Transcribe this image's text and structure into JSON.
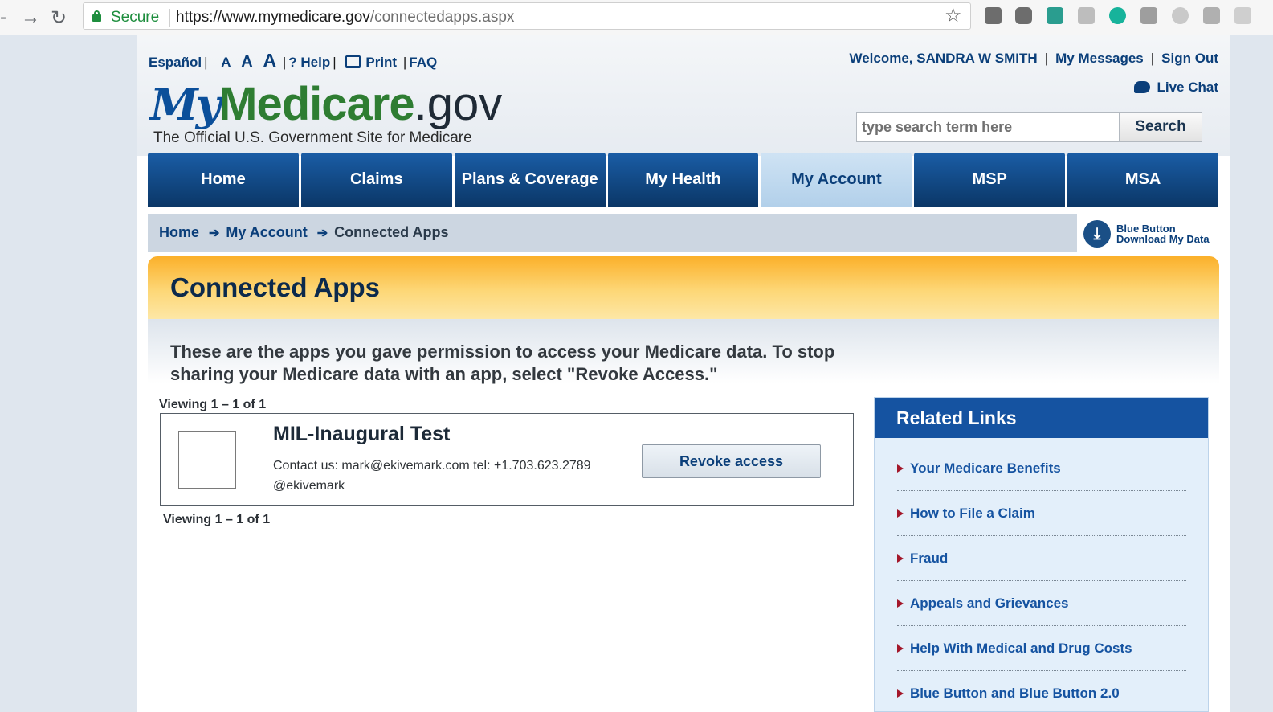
{
  "browser": {
    "secure_label": "Secure",
    "url_host": "https://www.mymedicare.gov",
    "url_path": "/connectedapps.aspx"
  },
  "utility": {
    "espanol": "Español",
    "font_small": "A",
    "font_medium": "A",
    "font_large": "A",
    "help": "? Help",
    "print": "Print",
    "faq": "FAQ"
  },
  "account": {
    "welcome": "Welcome, SANDRA W SMITH",
    "messages": "My Messages",
    "sign_out": "Sign Out",
    "live_chat": "Live Chat"
  },
  "logo": {
    "my": "My",
    "medicare": "Medicare",
    "gov": ".gov",
    "tagline": "The Official U.S. Government Site for Medicare"
  },
  "search": {
    "placeholder": "type search term here",
    "button": "Search"
  },
  "nav": {
    "tabs": [
      {
        "label": "Home",
        "active": false
      },
      {
        "label": "Claims",
        "active": false
      },
      {
        "label": "Plans & Coverage",
        "active": false
      },
      {
        "label": "My Health",
        "active": false
      },
      {
        "label": "My Account",
        "active": true
      },
      {
        "label": "MSP",
        "active": false
      },
      {
        "label": "MSA",
        "active": false
      }
    ]
  },
  "breadcrumb": {
    "items": [
      "Home",
      "My Account",
      "Connected Apps"
    ]
  },
  "blue_button": {
    "line1": "Blue Button",
    "line2": "Download My Data"
  },
  "page": {
    "title": "Connected Apps",
    "intro": "These are the apps you gave permission to access your Medicare data. To stop sharing your Medicare data with an app, select \"Revoke Access.\"",
    "viewing_top": "Viewing 1 – 1 of 1",
    "viewing_bottom": "Viewing 1 – 1 of 1"
  },
  "apps": [
    {
      "name": "MIL-Inaugural Test",
      "contact": "Contact us: mark@ekivemark.com tel: +1.703.623.2789 @ekivemark",
      "action": "Revoke access"
    }
  ],
  "related_links": {
    "title": "Related Links",
    "items": [
      "Your Medicare Benefits",
      "How to File a Claim",
      "Fraud",
      "Appeals and Grievances",
      "Help With Medical and Drug Costs",
      "Blue Button and Blue Button 2.0"
    ]
  },
  "colors": {
    "nav_blue": "#0b3767",
    "active_tab": "#b2d0ea",
    "title_band": "#fbb02a",
    "link_blue": "#1553a1",
    "bullet_red": "#a3172a"
  }
}
